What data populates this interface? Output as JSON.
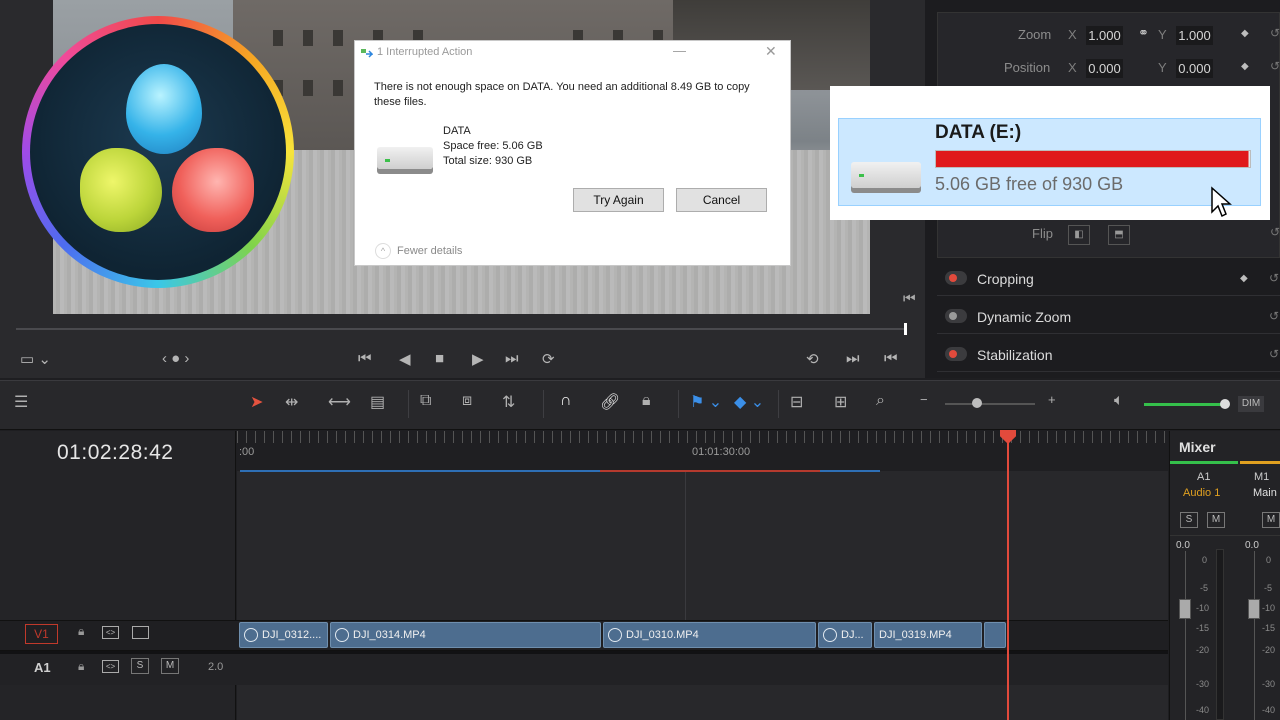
{
  "dialog": {
    "title": "1 Interrupted Action",
    "message": "There is not enough space on DATA. You need an additional 8.49 GB to copy these files.",
    "drive_name": "DATA",
    "space_free": "Space free: 5.06 GB",
    "total_size": "Total size: 930 GB",
    "try_again": "Try Again",
    "cancel": "Cancel",
    "fewer_details": "Fewer details",
    "minimize_glyph": "—",
    "close_glyph": "✕"
  },
  "drive_callout": {
    "name": "DATA (E:)",
    "free_text": "5.06 GB free of 930 GB",
    "used_fraction": 0.9946,
    "bar_color": "#e0191b"
  },
  "inspector": {
    "zoom_label": "Zoom",
    "position_label": "Position",
    "flip_label": "Flip",
    "axis_x": "X",
    "axis_y": "Y",
    "zoom_x": "1.000",
    "zoom_y": "1.000",
    "position_x": "0.000",
    "position_y": "0.000",
    "sections": [
      {
        "name": "Cropping",
        "enabled": true
      },
      {
        "name": "Dynamic Zoom",
        "enabled": false
      },
      {
        "name": "Stabilization",
        "enabled": true
      }
    ]
  },
  "timeline": {
    "timecode": "01:02:28:42",
    "ruler_start": ":00",
    "ruler_mark": "01:01:30:00",
    "video_track": "V1",
    "audio_track": "A1",
    "audio_level": "2.0",
    "solo_label": "S",
    "mute_label": "M",
    "clips": [
      "DJI_0312....",
      "DJI_0314.MP4",
      "DJI_0310.MP4",
      "DJ...",
      "DJI_0319.MP4",
      ""
    ]
  },
  "mixer": {
    "title": "Mixer",
    "channel_a1": "A1",
    "channel_m1": "M1",
    "track_audio1": "Audio 1",
    "track_main": "Main",
    "solo_label": "S",
    "mute_label": "M",
    "level_a1": "0.0",
    "level_m1": "0.0",
    "db_scale": [
      "0",
      "-5",
      "-10",
      "-15",
      "-20",
      "-30",
      "-40"
    ]
  },
  "toolbar": {
    "dim_label": "DIM"
  },
  "colors": {
    "accent_red": "#e24a3c",
    "clip_blue": "#4d6d8f",
    "audio_orange": "#e0a020",
    "volume_green": "#35c04b"
  }
}
